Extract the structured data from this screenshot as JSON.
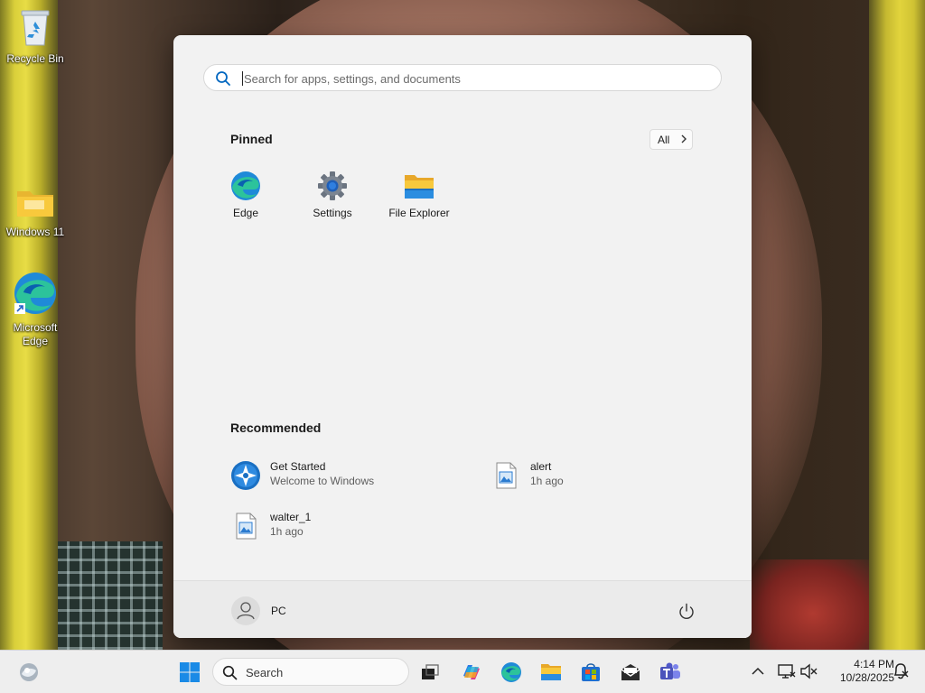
{
  "desktop": {
    "icons": [
      {
        "label": "Recycle Bin",
        "icon": "recycle-bin-icon"
      },
      {
        "label": "Windows 11",
        "icon": "folder-icon"
      },
      {
        "label": "Microsoft Edge",
        "icon": "edge-icon"
      }
    ]
  },
  "start_menu": {
    "search": {
      "placeholder": "Search for apps, settings, and documents",
      "value": ""
    },
    "pinned_title": "Pinned",
    "all_button": "All",
    "pinned": [
      {
        "label": "Edge",
        "icon": "edge-icon"
      },
      {
        "label": "Settings",
        "icon": "settings-gear-icon"
      },
      {
        "label": "File Explorer",
        "icon": "file-explorer-icon"
      }
    ],
    "recommended_title": "Recommended",
    "recommended": [
      {
        "title": "Get Started",
        "subtitle": "Welcome to Windows",
        "icon": "get-started-icon"
      },
      {
        "title": "alert",
        "subtitle": "1h ago",
        "icon": "image-file-icon"
      },
      {
        "title": "walter_1",
        "subtitle": "1h ago",
        "icon": "image-file-icon"
      }
    ],
    "user": {
      "name": "PC"
    },
    "power_icon": "power-icon"
  },
  "taskbar": {
    "search_label": "Search",
    "apps": [
      "widgets-icon",
      "start-icon",
      "task-view-icon",
      "copilot-icon",
      "edge-icon",
      "file-explorer-icon",
      "store-icon",
      "mail-icon",
      "teams-icon"
    ],
    "tray": [
      "chevron-up-icon",
      "network-icon",
      "volume-muted-icon",
      "notification-icon"
    ],
    "time": "4:14 PM",
    "date": "10/28/2025"
  },
  "colors": {
    "accent": "#0067c0",
    "start_bg": "#f2f2f2",
    "taskbar_bg": "#eeeeee",
    "folder_yellow": "#f8c93c"
  }
}
